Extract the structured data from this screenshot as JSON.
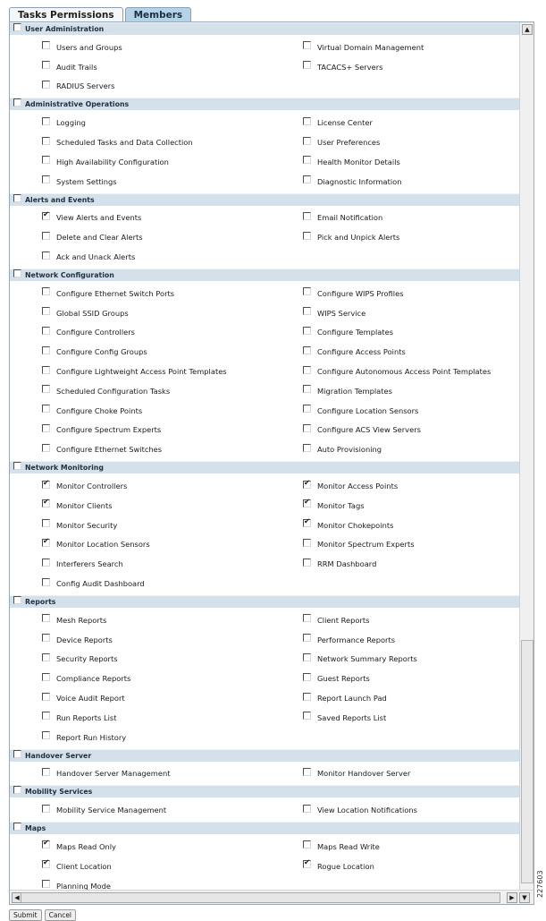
{
  "tabs": [
    {
      "label": "Tasks Permissions",
      "active": true
    },
    {
      "label": "Members",
      "active": false
    }
  ],
  "sections": [
    {
      "title": "User Administration",
      "checked": false,
      "items": [
        {
          "label": "Users and Groups",
          "checked": false
        },
        {
          "label": "Virtual Domain Management",
          "checked": false
        },
        {
          "label": "Audit Trails",
          "checked": false
        },
        {
          "label": "TACACS+ Servers",
          "checked": false
        },
        {
          "label": "RADIUS Servers",
          "checked": false
        }
      ]
    },
    {
      "title": "Administrative Operations",
      "checked": false,
      "items": [
        {
          "label": "Logging",
          "checked": false
        },
        {
          "label": "License Center",
          "checked": false
        },
        {
          "label": "Scheduled Tasks and Data Collection",
          "checked": false
        },
        {
          "label": "User Preferences",
          "checked": false
        },
        {
          "label": "High Availability Configuration",
          "checked": false
        },
        {
          "label": "Health Monitor Details",
          "checked": false
        },
        {
          "label": "System Settings",
          "checked": false
        },
        {
          "label": "Diagnostic Information",
          "checked": false
        }
      ]
    },
    {
      "title": "Alerts and Events",
      "checked": false,
      "items": [
        {
          "label": "View Alerts and Events",
          "checked": true
        },
        {
          "label": "Email Notification",
          "checked": false
        },
        {
          "label": "Delete and Clear Alerts",
          "checked": false
        },
        {
          "label": "Pick and Unpick Alerts",
          "checked": false
        },
        {
          "label": "Ack and Unack Alerts",
          "checked": false
        }
      ]
    },
    {
      "title": "Network Configuration",
      "checked": false,
      "items": [
        {
          "label": "Configure Ethernet Switch Ports",
          "checked": false
        },
        {
          "label": "Configure WIPS Profiles",
          "checked": false
        },
        {
          "label": "Global SSID Groups",
          "checked": false
        },
        {
          "label": "WIPS Service",
          "checked": false
        },
        {
          "label": "Configure Controllers",
          "checked": false
        },
        {
          "label": "Configure Templates",
          "checked": false
        },
        {
          "label": "Configure Config Groups",
          "checked": false
        },
        {
          "label": "Configure Access Points",
          "checked": false
        },
        {
          "label": "Configure Lightweight Access Point Templates",
          "checked": false
        },
        {
          "label": "Configure Autonomous Access Point Templates",
          "checked": false
        },
        {
          "label": "Scheduled Configuration Tasks",
          "checked": false
        },
        {
          "label": "Migration Templates",
          "checked": false
        },
        {
          "label": "Configure Choke Points",
          "checked": false
        },
        {
          "label": "Configure Location Sensors",
          "checked": false
        },
        {
          "label": "Configure Spectrum Experts",
          "checked": false
        },
        {
          "label": "Configure ACS View Servers",
          "checked": false
        },
        {
          "label": "Configure Ethernet Switches",
          "checked": false
        },
        {
          "label": "Auto Provisioning",
          "checked": false
        }
      ]
    },
    {
      "title": "Network Monitoring",
      "checked": false,
      "items": [
        {
          "label": "Monitor Controllers",
          "checked": true
        },
        {
          "label": "Monitor Access Points",
          "checked": true
        },
        {
          "label": "Monitor Clients",
          "checked": true
        },
        {
          "label": "Monitor Tags",
          "checked": true
        },
        {
          "label": "Monitor Security",
          "checked": false
        },
        {
          "label": "Monitor Chokepoints",
          "checked": true
        },
        {
          "label": "Monitor Location Sensors",
          "checked": true
        },
        {
          "label": "Monitor Spectrum Experts",
          "checked": false
        },
        {
          "label": "Interferers Search",
          "checked": false
        },
        {
          "label": "RRM Dashboard",
          "checked": false
        },
        {
          "label": "Config Audit Dashboard",
          "checked": false
        }
      ]
    },
    {
      "title": "Reports",
      "checked": false,
      "items": [
        {
          "label": "Mesh Reports",
          "checked": false
        },
        {
          "label": "Client Reports",
          "checked": false
        },
        {
          "label": "Device Reports",
          "checked": false
        },
        {
          "label": "Performance Reports",
          "checked": false
        },
        {
          "label": "Security Reports",
          "checked": false
        },
        {
          "label": "Network Summary Reports",
          "checked": false
        },
        {
          "label": "Compliance Reports",
          "checked": false
        },
        {
          "label": "Guest Reports",
          "checked": false
        },
        {
          "label": "Voice Audit Report",
          "checked": false
        },
        {
          "label": "Report Launch Pad",
          "checked": false
        },
        {
          "label": "Run Reports List",
          "checked": false
        },
        {
          "label": "Saved Reports List",
          "checked": false
        },
        {
          "label": "Report Run History",
          "checked": false
        }
      ]
    },
    {
      "title": "Handover Server",
      "checked": false,
      "items": [
        {
          "label": "Handover Server Management",
          "checked": false
        },
        {
          "label": "Monitor Handover Server",
          "checked": false
        }
      ]
    },
    {
      "title": "Mobility Services",
      "checked": false,
      "items": [
        {
          "label": "Mobility Service Management",
          "checked": false
        },
        {
          "label": "View Location Notifications",
          "checked": false
        }
      ]
    },
    {
      "title": "Maps",
      "checked": false,
      "items": [
        {
          "label": "Maps Read Only",
          "checked": true
        },
        {
          "label": "Maps Read Write",
          "checked": false
        },
        {
          "label": "Client Location",
          "checked": true
        },
        {
          "label": "Rogue Location",
          "checked": true
        },
        {
          "label": "Planning Mode",
          "checked": false
        }
      ]
    }
  ],
  "buttons": {
    "submit": "Submit",
    "cancel": "Cancel"
  },
  "side_code": "227603"
}
